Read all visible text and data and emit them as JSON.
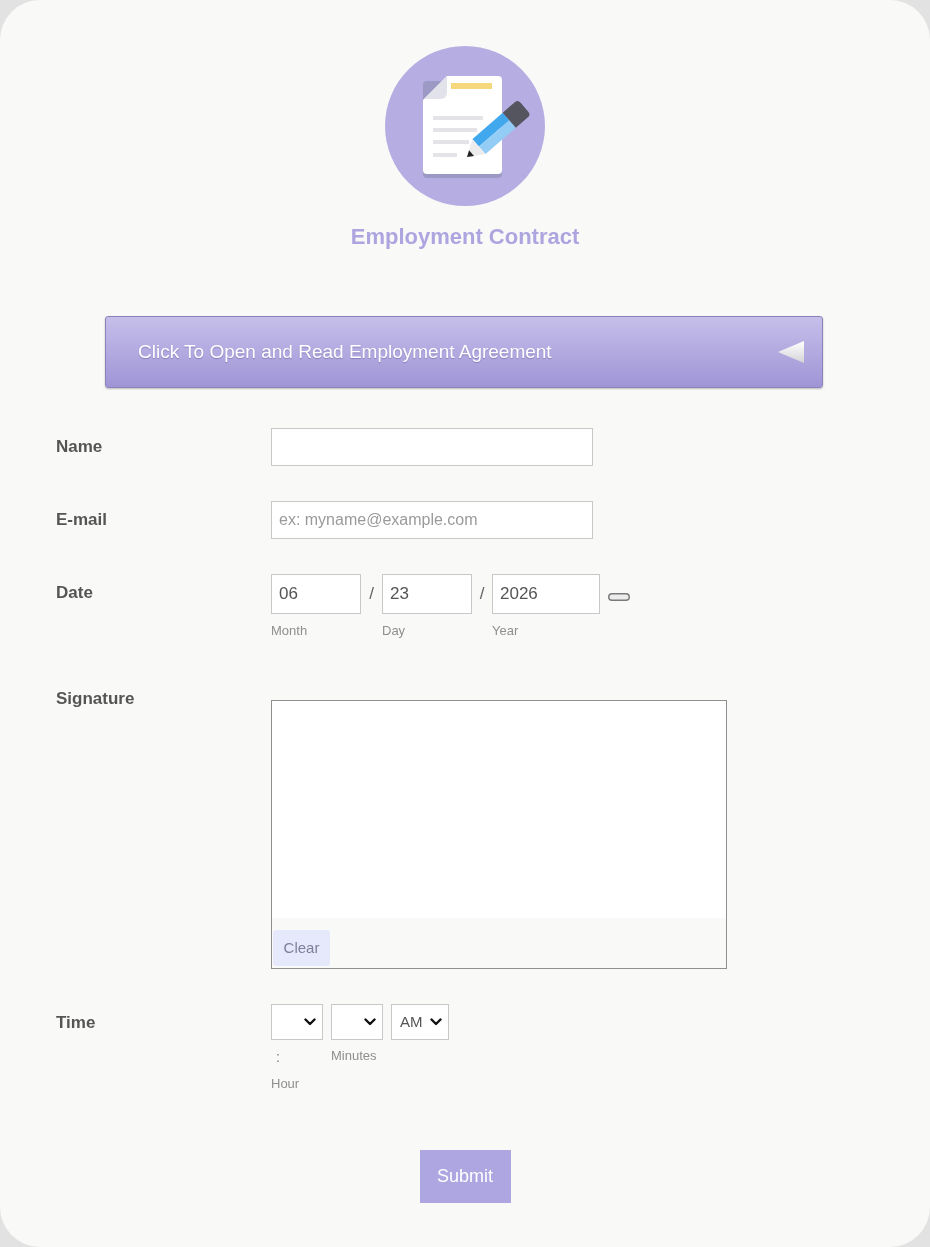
{
  "header": {
    "title": "Employment Contract"
  },
  "agreement": {
    "label": "Click To Open and Read Employment Agreement",
    "expanded": false
  },
  "fields": [
    {
      "kind": "text",
      "label": "Name"
    },
    {
      "kind": "text",
      "label": "E-mail",
      "placeholder": "ex: myname@example.com"
    },
    {
      "kind": "date",
      "label": "Date",
      "parts": [
        {
          "value": "06",
          "sublabel": "Month",
          "separator": "/"
        },
        {
          "value": "23",
          "sublabel": "Day",
          "separator": "/"
        },
        {
          "value": "2026",
          "sublabel": "Year"
        }
      ]
    },
    {
      "kind": "signature",
      "label": "Signature",
      "clear_label": "Clear"
    },
    {
      "kind": "time",
      "label": "Time",
      "selects": [
        {
          "separator": ":",
          "sublabel": "Hour"
        },
        {
          "sublabel": "Minutes"
        },
        {
          "value": "AM"
        }
      ]
    }
  ],
  "submit": {
    "label": "Submit"
  }
}
